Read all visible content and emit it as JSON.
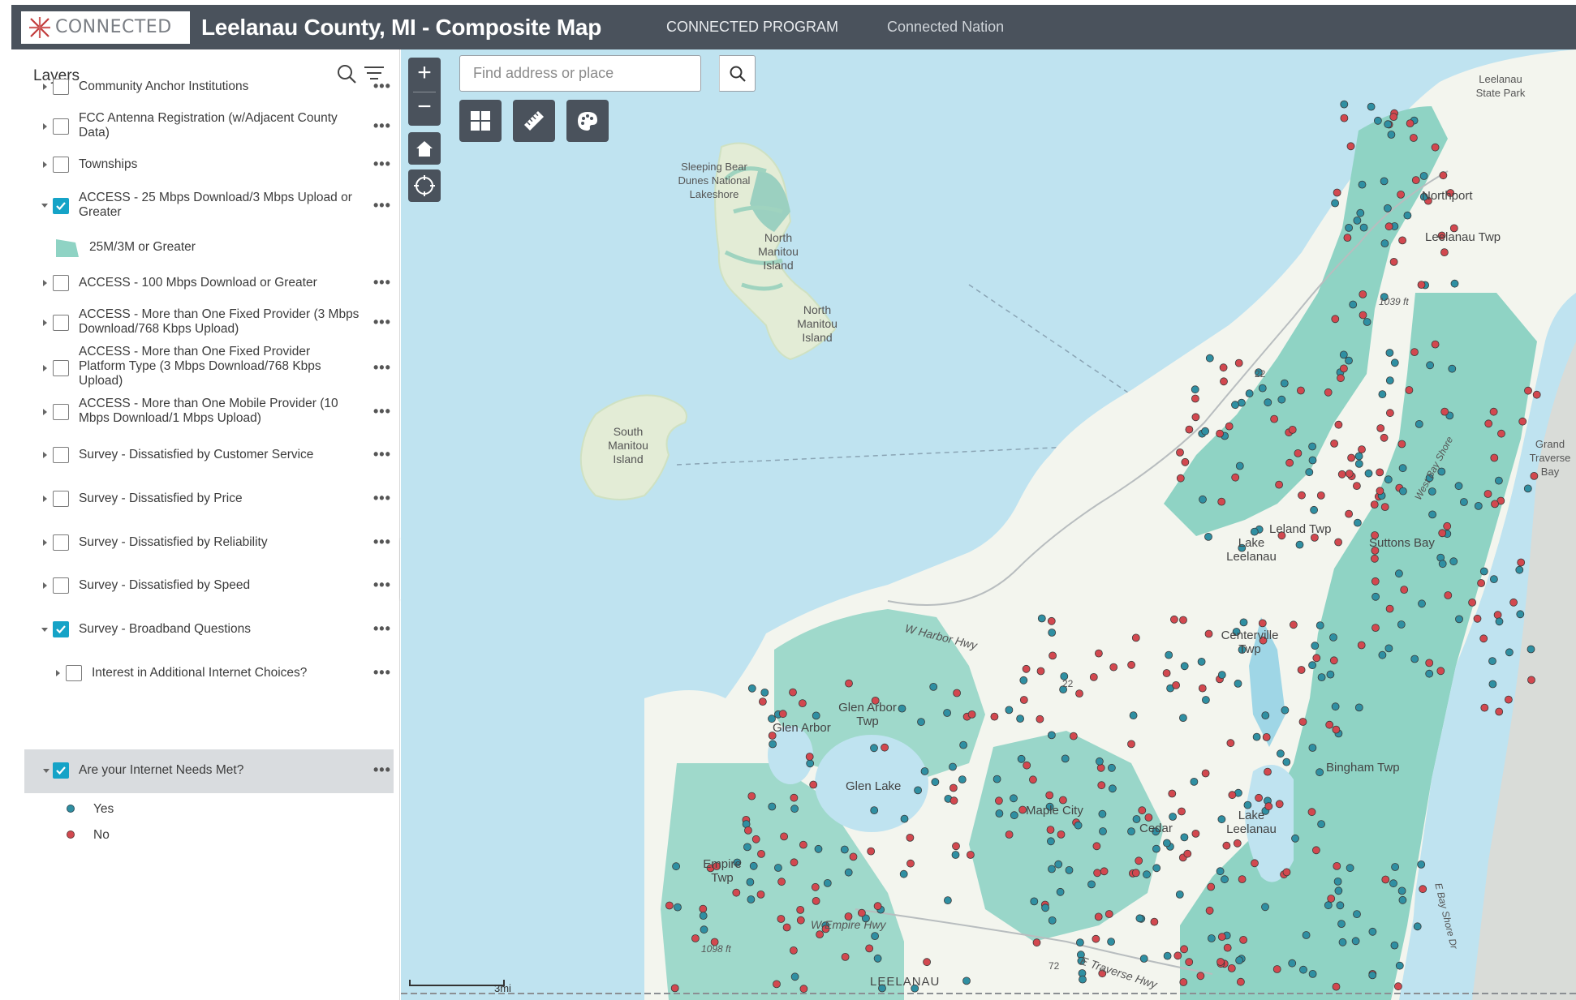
{
  "header": {
    "logo_text": "CONNECTED",
    "title": "Leelanau County, MI - Composite Map",
    "links": [
      "CONNECTED PROGRAM",
      "Connected Nation"
    ]
  },
  "panel": {
    "title": "Layers",
    "layers": [
      {
        "label": "Community Anchor Institutions",
        "checked": false
      },
      {
        "label": "FCC Antenna Registration (w/Adjacent County Data)",
        "checked": false
      },
      {
        "label": "Townships",
        "checked": false
      },
      {
        "label": "ACCESS - 25 Mbps Download/3 Mbps Upload or Greater",
        "checked": true
      },
      {
        "label": "ACCESS - 100 Mbps Download or Greater",
        "checked": false
      },
      {
        "label": "ACCESS - More than One Fixed Provider (3 Mbps Download/768 Kbps Upload)",
        "checked": false
      },
      {
        "label": "ACCESS - More than One Fixed Provider Platform Type (3 Mbps Download/768 Kbps Upload)",
        "checked": false
      },
      {
        "label": "ACCESS - More than One Mobile Provider (10 Mbps Download/1 Mbps Upload)",
        "checked": false
      },
      {
        "label": "Survey - Dissatisfied by Customer Service",
        "checked": false
      },
      {
        "label": "Survey - Dissatisfied by Price",
        "checked": false
      },
      {
        "label": "Survey - Dissatisfied by Reliability",
        "checked": false
      },
      {
        "label": "Survey - Dissatisfied by Speed",
        "checked": false
      },
      {
        "label": "Survey - Broadband Questions",
        "checked": true
      },
      {
        "label": "Interest in Additional Internet Choices?",
        "checked": false
      },
      {
        "label": "Are your Internet Needs Met?",
        "checked": true
      }
    ],
    "legend_access": "25M/3M or Greater",
    "legend_yes": "Yes",
    "legend_no": "No",
    "more_glyph": "•••"
  },
  "map": {
    "search_placeholder": "Find address or place",
    "zoom_in": "+",
    "zoom_out": "−",
    "scale_label": "3mi",
    "labels": {
      "sleeping_bear": "Sleeping Bear Dunes National Lakeshore",
      "north_manitou_1": "North Manitou Island",
      "north_manitou_2": "North Manitou Island",
      "south_manitou": "South Manitou Island",
      "leelanau_state_park": "Leelanau State Park",
      "northport": "Northport",
      "leelanau_twp": "Leelanau Twp",
      "elev_1039": "1039 ft",
      "leland_twp": "Leland Twp",
      "lake_leelanau_n": "Lake Leelanau",
      "suttons_bay": "Suttons Bay",
      "centerville": "Centerville Twp",
      "harbor_hwy": "W Harbor Hwy",
      "glen_arbor_twp": "Glen Arbor Twp",
      "glen_arbor": "Glen Arbor",
      "glen_lake": "Glen Lake",
      "maple_city": "Maple City",
      "cedar": "Cedar",
      "lake_leelanau_s": "Lake Leelanau",
      "bingham": "Bingham Twp",
      "empire": "Empire Twp",
      "empire_hwy": "W Empire Hwy",
      "elev_1098": "1098 ft",
      "leelanau": "LEELANAU",
      "traverse_hwy": "E Traverse Hwy",
      "grand_traverse_bay": "Grand Traverse Bay",
      "rt22_a": "22",
      "rt22_b": "22",
      "rt72": "72",
      "west_bay_shore": "West Bay Shore",
      "east_bay_shore": "E Bay Shore Dr"
    }
  },
  "colors": {
    "header_bg": "#4a525c",
    "checkbox_on": "#15a3c7",
    "water": "#bfe3f0",
    "land": "#f3f5ee",
    "access_fill": "#8fd3c4",
    "yes_dot": "#2f8fa2",
    "no_dot": "#d2484f"
  }
}
